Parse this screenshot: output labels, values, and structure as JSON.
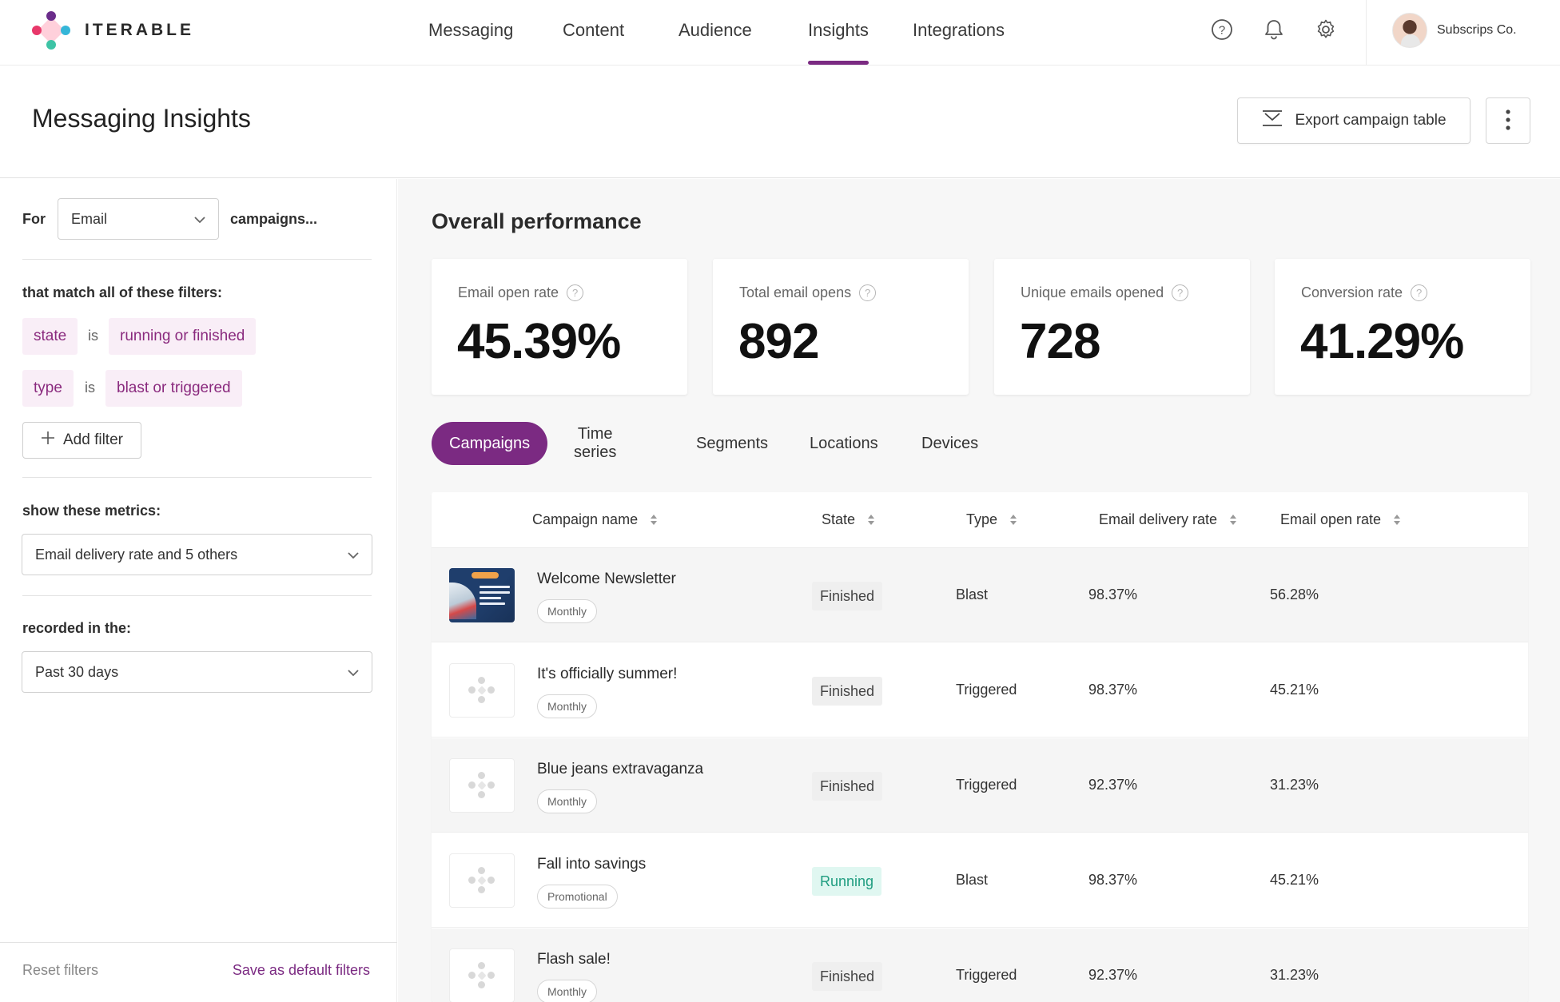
{
  "brand": {
    "name": "ITERABLE"
  },
  "nav": {
    "items": [
      "Messaging",
      "Content",
      "Audience",
      "Insights",
      "Integrations"
    ],
    "active": "Insights"
  },
  "account": {
    "name": "Subscrips Co."
  },
  "header": {
    "title": "Messaging Insights",
    "export_label": "Export campaign table"
  },
  "sidebar": {
    "for_label": "For",
    "channel_value": "Email",
    "campaigns_suffix": "campaigns...",
    "filters_heading": "that match all of these filters:",
    "filters": [
      {
        "field": "state",
        "op": "is",
        "value": "running or finished"
      },
      {
        "field": "type",
        "op": "is",
        "value": "blast or triggered"
      }
    ],
    "add_filter_label": "Add filter",
    "metrics_heading": "show these metrics:",
    "metrics_value": "Email delivery rate and 5 others",
    "recorded_heading": "recorded in the:",
    "recorded_value": "Past 30 days",
    "reset_label": "Reset filters",
    "save_label": "Save as default filters"
  },
  "overview": {
    "title": "Overall performance",
    "cards": [
      {
        "label": "Email open rate",
        "value": "45.39%"
      },
      {
        "label": "Total email opens",
        "value": "892"
      },
      {
        "label": "Unique emails opened",
        "value": "728"
      },
      {
        "label": "Conversion rate",
        "value": "41.29%"
      }
    ]
  },
  "tabs": [
    "Campaigns",
    "Time series",
    "Segments",
    "Locations",
    "Devices"
  ],
  "table": {
    "columns": [
      "Campaign name",
      "State",
      "Type",
      "Email delivery rate",
      "Email open rate"
    ],
    "rows": [
      {
        "name": "Welcome Newsletter",
        "tag": "Monthly",
        "state": "Finished",
        "type": "Blast",
        "delivery": "98.37%",
        "open": "56.28%"
      },
      {
        "name": "It's officially summer!",
        "tag": "Monthly",
        "state": "Finished",
        "type": "Triggered",
        "delivery": "98.37%",
        "open": "45.21%"
      },
      {
        "name": "Blue jeans extravaganza",
        "tag": "Monthly",
        "state": "Finished",
        "type": "Triggered",
        "delivery": "92.37%",
        "open": "31.23%"
      },
      {
        "name": "Fall into savings",
        "tag": "Promotional",
        "state": "Running",
        "type": "Blast",
        "delivery": "98.37%",
        "open": "45.21%"
      },
      {
        "name": "Flash sale!",
        "tag": "Monthly",
        "state": "Finished",
        "type": "Triggered",
        "delivery": "92.37%",
        "open": "31.23%"
      }
    ]
  },
  "colors": {
    "accent": "#7b2a82",
    "chip_bg": "#f9eef7",
    "running_bg": "#e0f7f1",
    "running_text": "#1f9d80"
  },
  "icons": {
    "help": "help-circle-icon",
    "bell": "bell-icon",
    "settings": "gear-icon",
    "export": "download-tray-icon",
    "more": "more-vertical-icon",
    "chevron": "chevron-down-icon",
    "plus": "plus-icon",
    "sort": "sort-icon"
  }
}
